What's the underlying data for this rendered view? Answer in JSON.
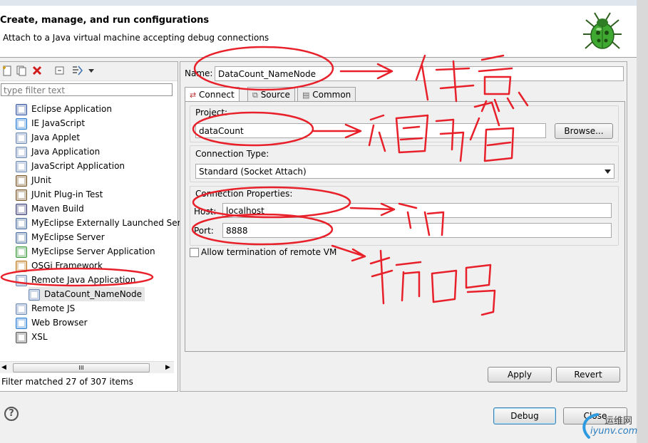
{
  "header": {
    "title": "Create, manage, and run configurations",
    "subtitle": "Attach to a Java virtual machine accepting debug connections"
  },
  "left_panel": {
    "filter_placeholder": "type filter text",
    "tree": [
      {
        "label": "Eclipse Application",
        "icon": "eclipse-icon",
        "color": "#3b5aa5"
      },
      {
        "label": "IE JavaScript",
        "icon": "globe-icon",
        "color": "#2a7fd4"
      },
      {
        "label": "Java Applet",
        "icon": "applet-icon",
        "color": "#6d89b3"
      },
      {
        "label": "Java Application",
        "icon": "java-app-icon",
        "color": "#6d89b3"
      },
      {
        "label": "JavaScript Application",
        "icon": "js-app-icon",
        "color": "#6d89b3"
      },
      {
        "label": "JUnit",
        "icon": "junit-icon",
        "color": "#7a5a2a"
      },
      {
        "label": "JUnit Plug-in Test",
        "icon": "junit-plugin-icon",
        "color": "#7a5a2a"
      },
      {
        "label": "Maven Build",
        "icon": "maven-icon",
        "color": "#40447a"
      },
      {
        "label": "MyEclipse Externally Launched Ser",
        "icon": "myeclipse-ext-icon",
        "color": "#4a6fa0"
      },
      {
        "label": "MyEclipse Server",
        "icon": "myeclipse-server-icon",
        "color": "#4a6fa0"
      },
      {
        "label": "MyEclipse Server Application",
        "icon": "myeclipse-server-app-icon",
        "color": "#3d9a3d"
      },
      {
        "label": "OSGi Framework",
        "icon": "osgi-icon",
        "color": "#c07a20"
      },
      {
        "label": "Remote Java Application",
        "icon": "remote-java-icon",
        "color": "#6d89b3"
      },
      {
        "label": "DataCount_NameNode",
        "icon": "remote-config-icon",
        "color": "#6d89b3",
        "child": true,
        "selected": true
      },
      {
        "label": "Remote JS",
        "icon": "remote-js-icon",
        "color": "#6d89b3"
      },
      {
        "label": "Web Browser",
        "icon": "browser-icon",
        "color": "#2a7fd4"
      },
      {
        "label": "XSL",
        "icon": "xsl-icon",
        "color": "#555555"
      }
    ],
    "scroll_label": "III",
    "filter_status": "Filter matched 27 of 307 items"
  },
  "form": {
    "name_label": "Name:",
    "name_value": "DataCount_NameNode",
    "tabs": [
      "Connect",
      "Source",
      "Common"
    ],
    "project_label": "Project:",
    "project_value": "dataCount",
    "browse_label": "Browse...",
    "connection_type_label": "Connection Type:",
    "connection_type_value": "Standard (Socket Attach)",
    "connection_props_label": "Connection Properties:",
    "host_label": "Host:",
    "host_value": "localhost",
    "port_label": "Port:",
    "port_value": "8888",
    "allow_termination_label": "Allow termination of remote VM",
    "apply_label": "Apply",
    "revert_label": "Revert"
  },
  "footer": {
    "help_symbol": "?",
    "debug_label": "Debug",
    "close_label": "Close"
  },
  "watermark": {
    "brand": "运维网",
    "domain": "iyunv.com"
  }
}
